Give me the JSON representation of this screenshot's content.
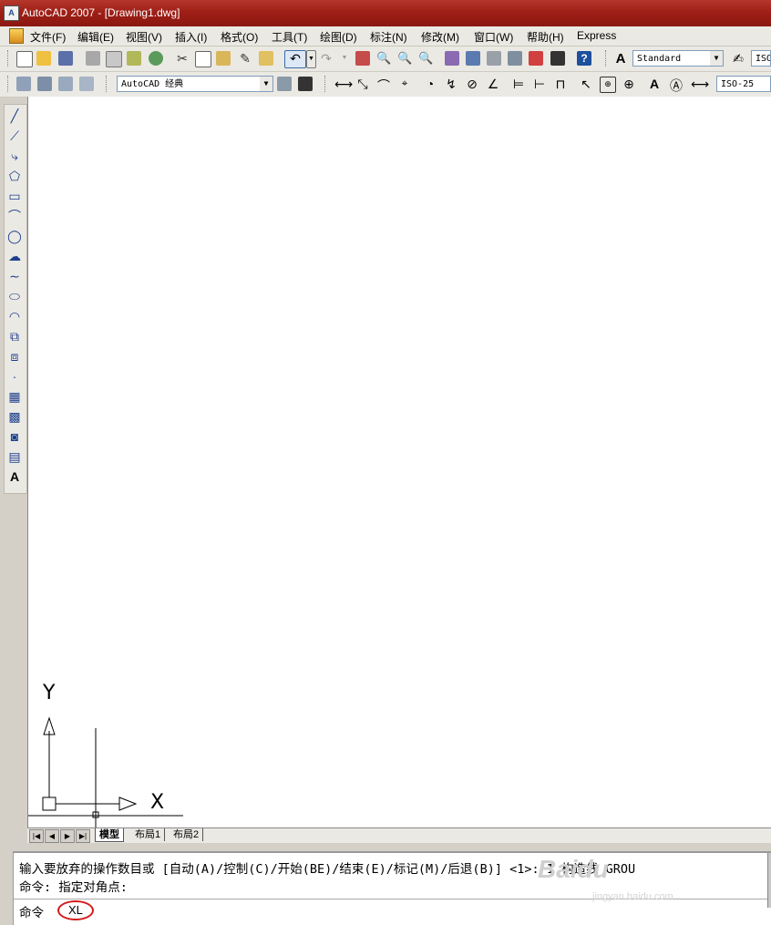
{
  "window": {
    "title": "AutoCAD 2007 - [Drawing1.dwg]",
    "app_icon": "autocad-logo-icon"
  },
  "menubar": {
    "items": [
      "文件(F)",
      "编辑(E)",
      "视图(V)",
      "插入(I)",
      "格式(O)",
      "工具(T)",
      "绘图(D)",
      "标注(N)",
      "修改(M)",
      "窗口(W)",
      "帮助(H)",
      "Express"
    ]
  },
  "toolbar1": {
    "text_style": "Standard",
    "dim_style_partial": "ISO"
  },
  "toolbar2": {
    "workspace": "AutoCAD 经典",
    "dim_style": "ISO-25"
  },
  "ucs": {
    "y_label": "Y",
    "x_label": "X"
  },
  "layout_tabs": {
    "tabs": [
      "模型",
      "布局1",
      "布局2"
    ],
    "active": "模型"
  },
  "command_window": {
    "history_line1": "输入要放弃的操作数目或 [自动(A)/控制(C)/开始(BE)/结束(E)/标记(M)/后退(B)] <1>: 1 构造线 GROU",
    "history_line2": "命令: 指定对角点:",
    "prompt_label": "命令",
    "current_input": "XL"
  },
  "watermark": {
    "text": "Baidu",
    "sub": "jingyan.baidu.com"
  },
  "colors": {
    "titlebar": "#a3231a",
    "highlight_circle": "#d41a1a",
    "canvas": "#ffffff"
  }
}
